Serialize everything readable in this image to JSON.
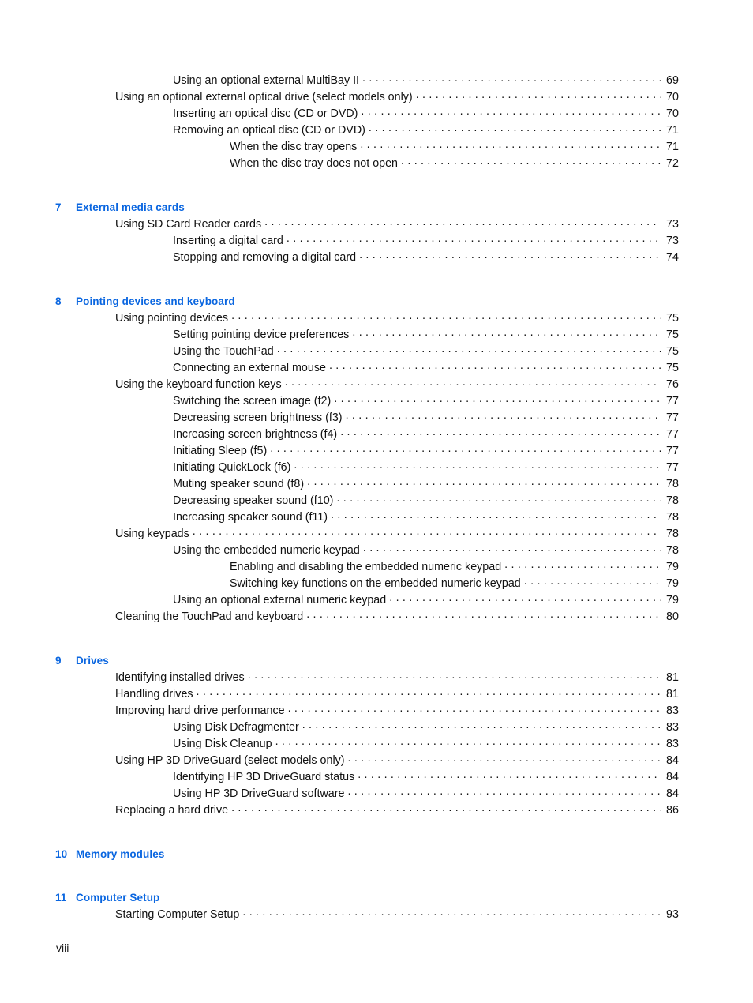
{
  "page": {
    "footer_label": "viii",
    "accent_color": "#0a66e0",
    "text_color": "#111111"
  },
  "toc": {
    "continued_entries": [
      {
        "label": "Using an optional external MultiBay II",
        "page": "69",
        "level": 2
      },
      {
        "label": "Using an optional external optical drive (select models only)",
        "page": "70",
        "level": 1
      },
      {
        "label": "Inserting an optical disc (CD or DVD)",
        "page": "70",
        "level": 2
      },
      {
        "label": "Removing an optical disc (CD or DVD)",
        "page": "71",
        "level": 2
      },
      {
        "label": "When the disc tray opens",
        "page": "71",
        "level": 3
      },
      {
        "label": "When the disc tray does not open",
        "page": "72",
        "level": 3
      }
    ],
    "chapters": [
      {
        "number": "7",
        "title": "External media cards",
        "entries": [
          {
            "label": "Using SD Card Reader cards",
            "page": "73",
            "level": 1
          },
          {
            "label": "Inserting a digital card",
            "page": "73",
            "level": 2
          },
          {
            "label": "Stopping and removing a digital card",
            "page": "74",
            "level": 2
          }
        ]
      },
      {
        "number": "8",
        "title": "Pointing devices and keyboard",
        "entries": [
          {
            "label": "Using pointing devices",
            "page": "75",
            "level": 1
          },
          {
            "label": "Setting pointing device preferences",
            "page": "75",
            "level": 2
          },
          {
            "label": "Using the TouchPad",
            "page": "75",
            "level": 2
          },
          {
            "label": "Connecting an external mouse",
            "page": "75",
            "level": 2
          },
          {
            "label": "Using the keyboard function keys",
            "page": "76",
            "level": 1
          },
          {
            "label": "Switching the screen image (f2)",
            "page": "77",
            "level": 2
          },
          {
            "label": "Decreasing screen brightness (f3)",
            "page": "77",
            "level": 2
          },
          {
            "label": "Increasing screen brightness (f4)",
            "page": "77",
            "level": 2
          },
          {
            "label": "Initiating Sleep (f5)",
            "page": "77",
            "level": 2
          },
          {
            "label": "Initiating QuickLock (f6)",
            "page": "77",
            "level": 2
          },
          {
            "label": "Muting speaker sound (f8)",
            "page": "78",
            "level": 2
          },
          {
            "label": "Decreasing speaker sound (f10)",
            "page": "78",
            "level": 2
          },
          {
            "label": "Increasing speaker sound (f11)",
            "page": "78",
            "level": 2
          },
          {
            "label": "Using keypads",
            "page": "78",
            "level": 1
          },
          {
            "label": "Using the embedded numeric keypad",
            "page": "78",
            "level": 2
          },
          {
            "label": "Enabling and disabling the embedded numeric keypad",
            "page": "79",
            "level": 3
          },
          {
            "label": "Switching key functions on the embedded numeric keypad",
            "page": "79",
            "level": 3
          },
          {
            "label": "Using an optional external numeric keypad",
            "page": "79",
            "level": 2
          },
          {
            "label": "Cleaning the TouchPad and keyboard",
            "page": "80",
            "level": 1
          }
        ]
      },
      {
        "number": "9",
        "title": "Drives",
        "entries": [
          {
            "label": "Identifying installed drives",
            "page": "81",
            "level": 1
          },
          {
            "label": "Handling drives",
            "page": "81",
            "level": 1
          },
          {
            "label": "Improving hard drive performance",
            "page": "83",
            "level": 1
          },
          {
            "label": "Using Disk Defragmenter",
            "page": "83",
            "level": 2
          },
          {
            "label": "Using Disk Cleanup",
            "page": "83",
            "level": 2
          },
          {
            "label": "Using HP 3D DriveGuard (select models only)",
            "page": "84",
            "level": 1
          },
          {
            "label": "Identifying HP 3D DriveGuard status",
            "page": "84",
            "level": 2
          },
          {
            "label": "Using HP 3D DriveGuard software",
            "page": "84",
            "level": 2
          },
          {
            "label": "Replacing a hard drive",
            "page": "86",
            "level": 1
          }
        ]
      },
      {
        "number": "10",
        "title": "Memory modules",
        "entries": []
      },
      {
        "number": "11",
        "title": "Computer Setup",
        "entries": [
          {
            "label": "Starting Computer Setup",
            "page": "93",
            "level": 1
          }
        ]
      }
    ]
  }
}
